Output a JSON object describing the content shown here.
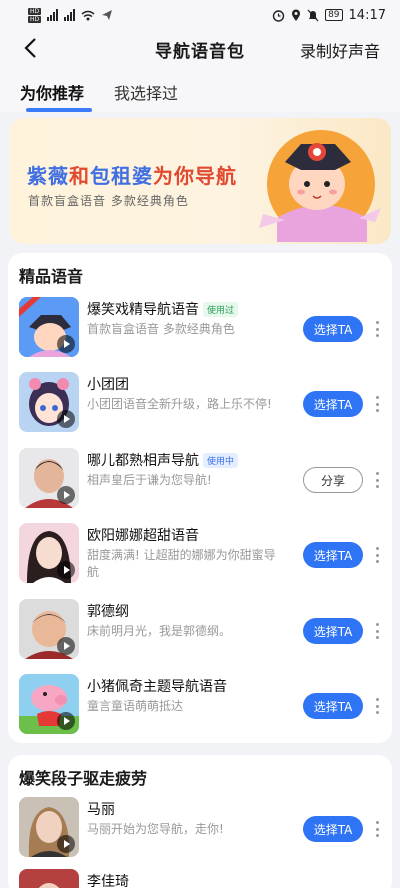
{
  "status": {
    "time": "14:17",
    "battery": "89",
    "sim_labels": [
      "HD",
      "HD"
    ]
  },
  "nav": {
    "title": "导航语音包",
    "action": "录制好声音",
    "back_icon": "chevron-left-icon"
  },
  "tabs": [
    {
      "label": "为你推荐",
      "active": true
    },
    {
      "label": "我选择过",
      "active": false
    }
  ],
  "banner": {
    "title_part1": "紫薇",
    "title_part2": "和",
    "title_part3": "包租婆",
    "title_part4": "为你导航",
    "subtitle": "首款盲盒语音   多款经典角色"
  },
  "section1": {
    "title": "精品语音",
    "items": [
      {
        "title": "爆笑戏精导航语音",
        "badge": "使用过",
        "desc": "首款盲盒语音 多款经典角色",
        "button": "选择TA"
      },
      {
        "title": "小团团",
        "badge": "",
        "desc": "小团团语音全新升级，路上乐不停!",
        "button": "选择TA"
      },
      {
        "title": "哪儿都熟相声导航",
        "badge": "使用中",
        "desc": "相声皇后于谦为您导航!",
        "button": "分享"
      },
      {
        "title": "欧阳娜娜超甜语音",
        "badge": "",
        "desc": "甜度满满! 让超甜的娜娜为你甜蜜导航",
        "button": "选择TA"
      },
      {
        "title": "郭德纲",
        "badge": "",
        "desc": "床前明月光，我是郭德纲。",
        "button": "选择TA"
      },
      {
        "title": "小猪佩奇主题导航语音",
        "badge": "",
        "desc": "童言童语萌萌抵达",
        "button": "选择TA"
      }
    ]
  },
  "section2": {
    "title": "爆笑段子驱走疲劳",
    "items": [
      {
        "title": "马丽",
        "badge": "",
        "desc": "马丽开始为您导航，走你!",
        "button": "选择TA"
      },
      {
        "title": "李佳琦",
        "badge": "",
        "desc": "",
        "button": ""
      }
    ]
  },
  "colors": {
    "accent": "#2f74f5",
    "banner_blue": "#3f6fe0",
    "banner_red": "#e14a31"
  }
}
